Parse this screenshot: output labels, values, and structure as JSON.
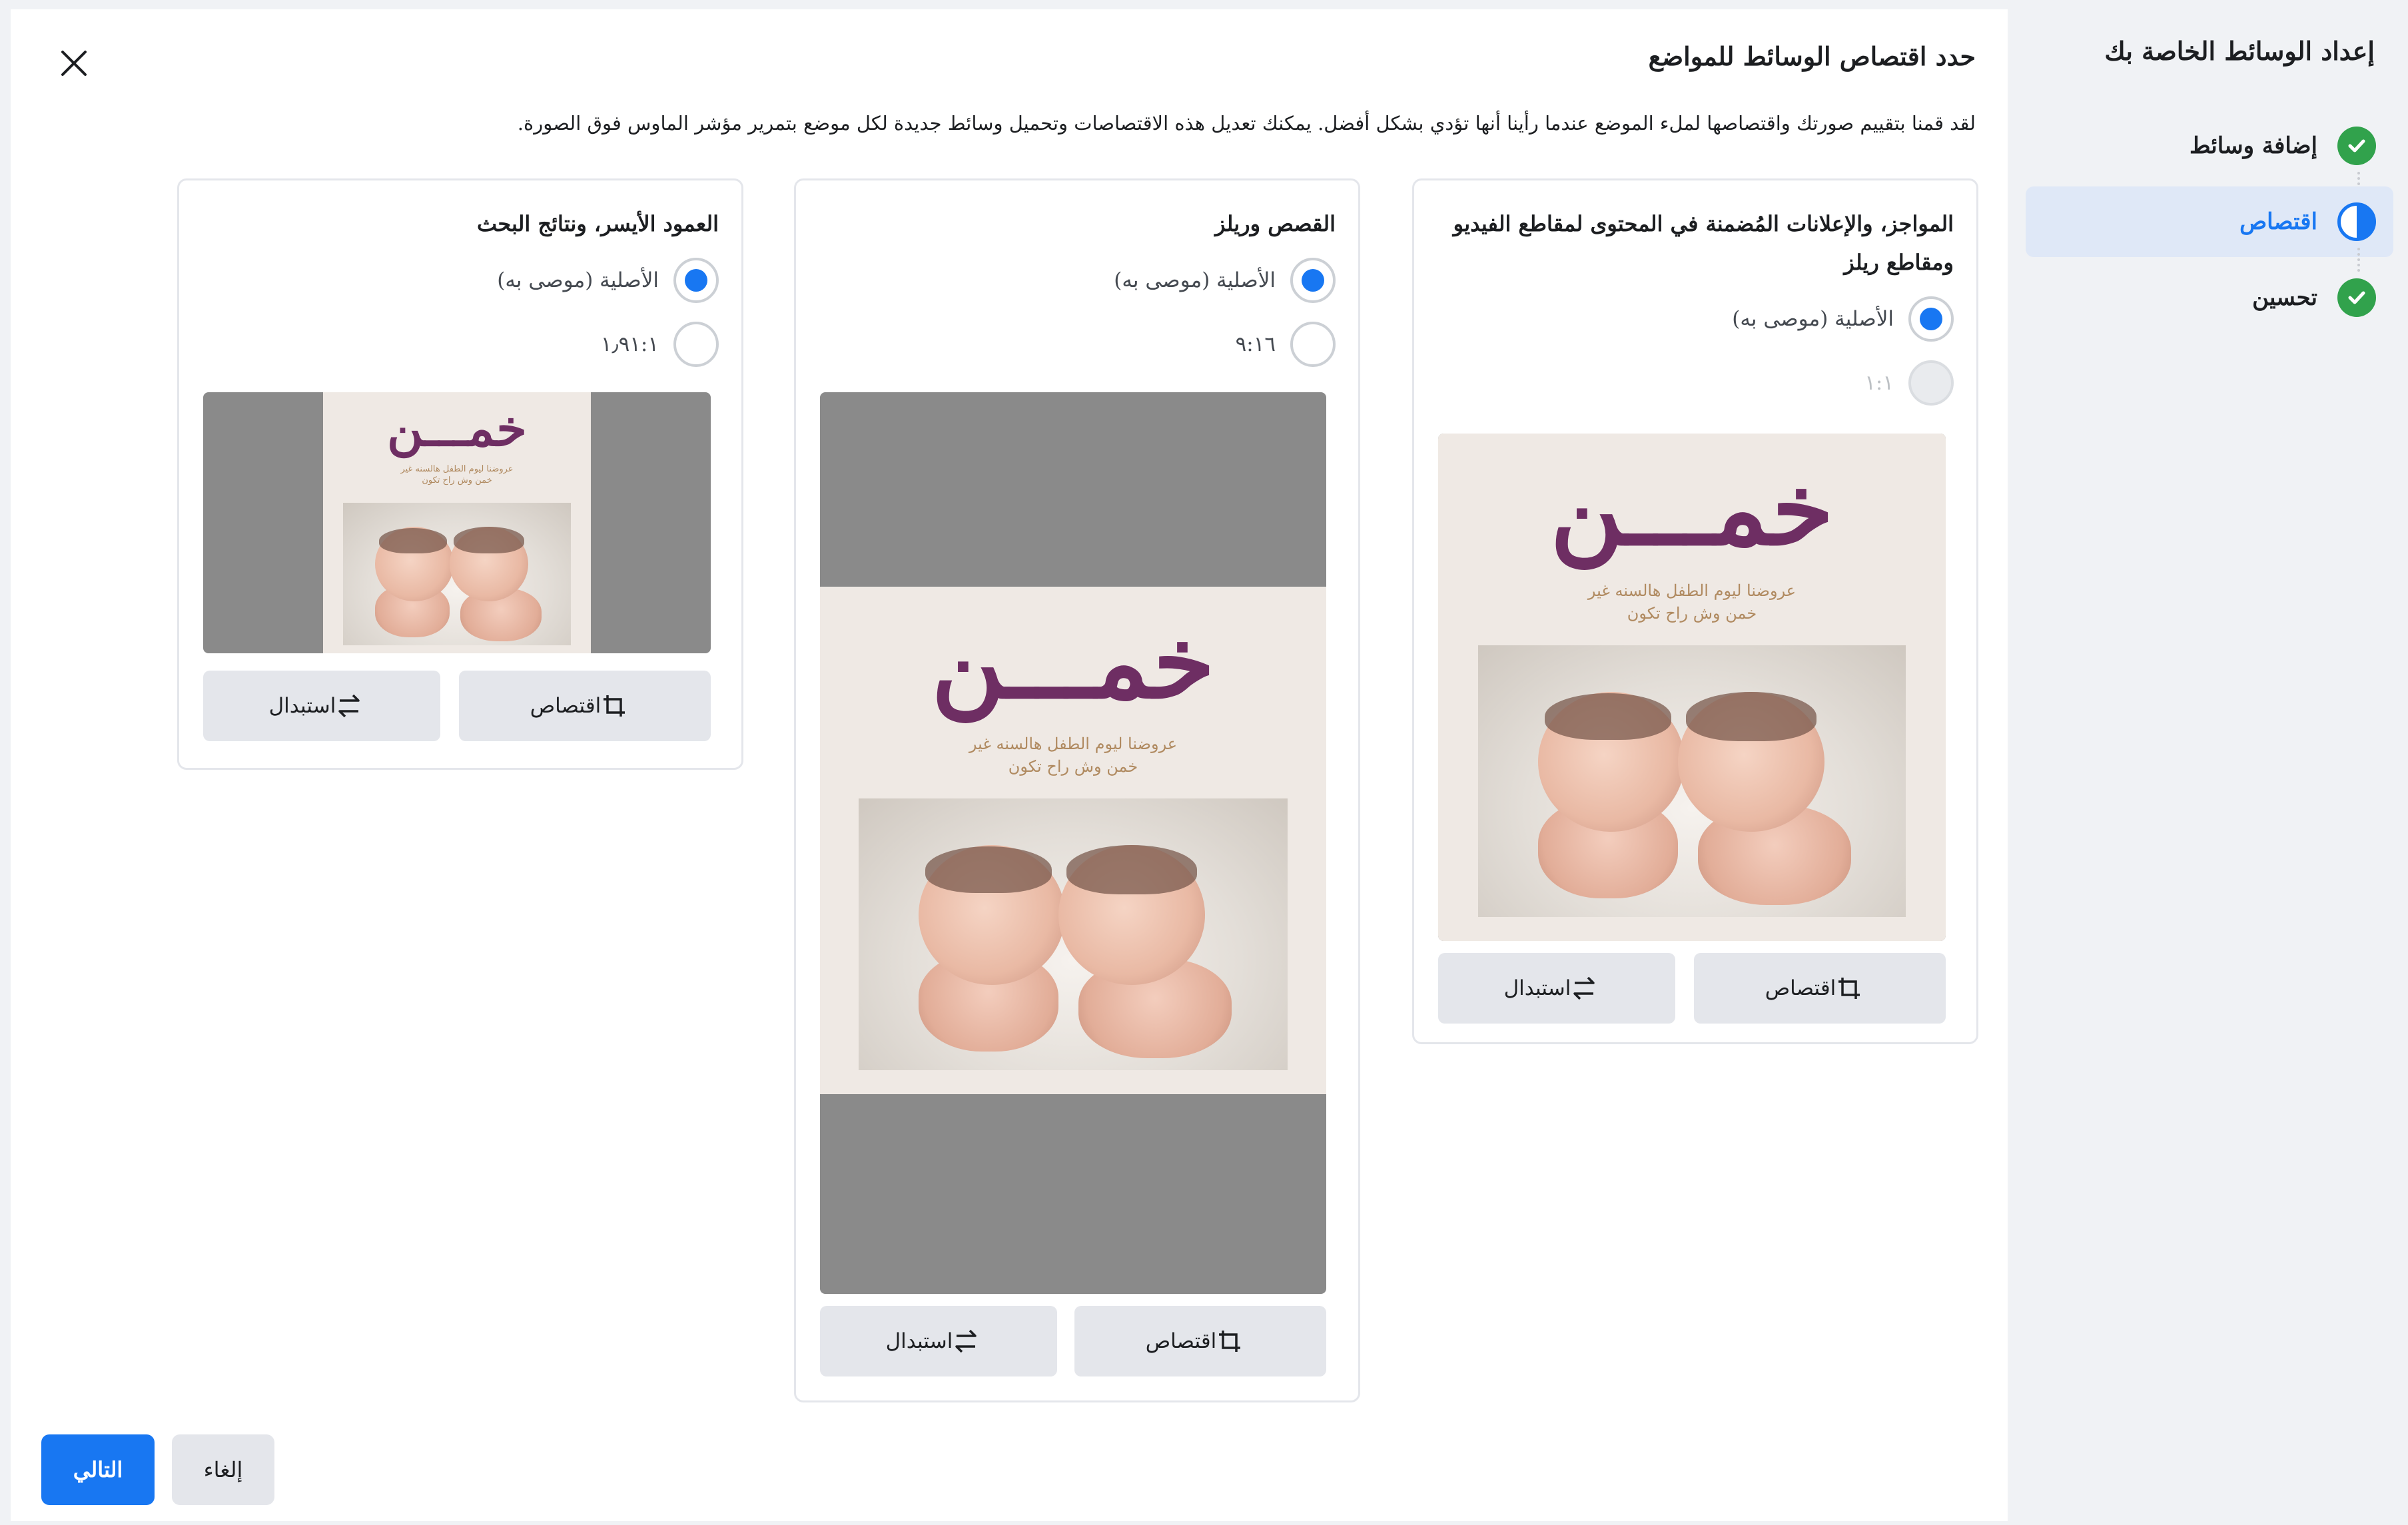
{
  "sidebar": {
    "title": "إعداد الوسائط الخاصة بك",
    "steps": [
      {
        "label": "إضافة وسائط",
        "state": "done"
      },
      {
        "label": "اقتصاص",
        "state": "active"
      },
      {
        "label": "تحسين",
        "state": "done"
      }
    ]
  },
  "header": {
    "title": "حدد اقتصاص الوسائط للمواضع",
    "description": "لقد قمنا بتقييم صورتك واقتصاصها لملء الموضع عندما رأينا أنها تؤدي بشكل أفضل. يمكنك تعديل هذه الاقتصاصات وتحميل وسائط جديدة لكل موضع بتمرير مؤشر الماوس فوق الصورة."
  },
  "poster": {
    "title": "خمـــن",
    "subtitle_line1": "عروضنا ليوم الطفل هالسنه غير",
    "subtitle_line2": "خمن وش راح تكون"
  },
  "cards": [
    {
      "title": "المواجز، والإعلانات المُضمنة في المحتوى لمقاطع الفيديو ومقاطع ريلز",
      "options": [
        {
          "label": "الأصلية (موصى به)",
          "selected": true,
          "disabled": false
        },
        {
          "label": "١:١",
          "selected": false,
          "disabled": true
        }
      ],
      "crop_label": "اقتصاص",
      "replace_label": "استبدال"
    },
    {
      "title": "القصص وريلز",
      "options": [
        {
          "label": "الأصلية (موصى به)",
          "selected": true,
          "disabled": false
        },
        {
          "label": "٩:١٦",
          "selected": false,
          "disabled": false
        }
      ],
      "crop_label": "اقتصاص",
      "replace_label": "استبدال"
    },
    {
      "title": "العمود الأيسر، ونتائج البحث",
      "options": [
        {
          "label": "الأصلية (موصى به)",
          "selected": true,
          "disabled": false
        },
        {
          "label": "١٫٩١:١",
          "selected": false,
          "disabled": false
        }
      ],
      "crop_label": "اقتصاص",
      "replace_label": "استبدال"
    }
  ],
  "footer": {
    "next_label": "التالي",
    "cancel_label": "إلغاء"
  },
  "colors": {
    "accent": "#1877f2",
    "success": "#31a24c",
    "poster_title": "#6e2e63",
    "letterbox": "#8a8a8a"
  },
  "icons": {
    "close": "close-icon",
    "check": "check-circle-icon",
    "progress": "half-circle-icon",
    "crop": "crop-icon",
    "replace": "swap-arrows-icon"
  }
}
